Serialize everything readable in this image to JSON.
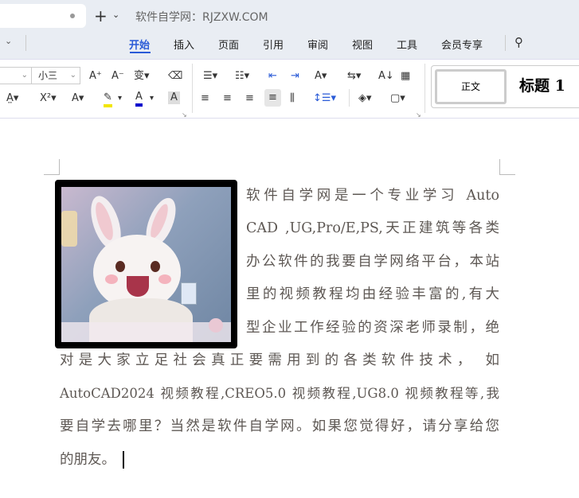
{
  "titlebar": {
    "new_tab": "+",
    "dropdown": "⌄",
    "site": "软件自学网：RJZXW.COM"
  },
  "menu": {
    "tabs": [
      "开始",
      "插入",
      "页面",
      "引用",
      "审阅",
      "视图",
      "工具",
      "会员专享"
    ],
    "active": "开始"
  },
  "ribbon": {
    "font_size": "小三",
    "styles": {
      "body": "正文",
      "heading1": "标题 1"
    },
    "accent": "#2a5bd7"
  },
  "document": {
    "lines": [
      "软件自学网是一个专业学习 Auto",
      "CAD ,UG,Pro/E,PS,天正建筑等各类",
      "办公软件的我要自学网络平台，本站",
      "里的视频教程均由经验丰富的,有大",
      "型企业工作经验的资深老师录制，绝",
      "对是大家立足社会真正要需用到的各类软件技术， 如",
      "AutoCAD2024 视频教程,CREO5.0 视频教程,UG8.0 视频教程等,我",
      "要自学去哪里？当然是软件自学网。如果您觉得好，请分享给您",
      "的朋友。"
    ]
  }
}
